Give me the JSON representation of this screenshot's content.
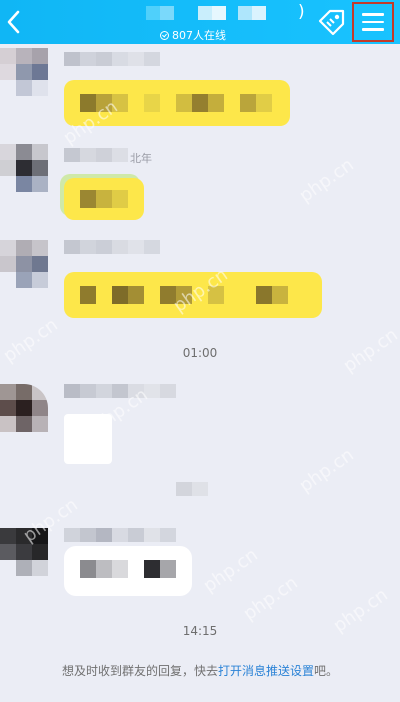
{
  "header": {
    "online_count": "807人在线",
    "title_suffix": ")"
  },
  "messages": [
    {
      "sender_suffix": ""
    },
    {
      "sender_suffix": "北年"
    },
    {
      "sender_suffix": ""
    },
    {
      "sender_suffix": ""
    },
    {
      "sender_suffix": ""
    }
  ],
  "timestamps": {
    "t1": "01:00",
    "t2": "14:15"
  },
  "notice": {
    "prefix": "想及时收到群友的回复，快去",
    "link": "打开消息推送设置",
    "suffix": "吧。"
  },
  "icons": {
    "back": "chevron-left-icon",
    "tag": "tag-icon",
    "menu": "hamburger-menu-icon",
    "online": "check-circle-icon"
  },
  "colors": {
    "header": "#19c3ff",
    "accent_frame": "#c23a2a",
    "bubble_yellow": "#fde74a",
    "link": "#2b83d6"
  },
  "watermark": "php.cn"
}
